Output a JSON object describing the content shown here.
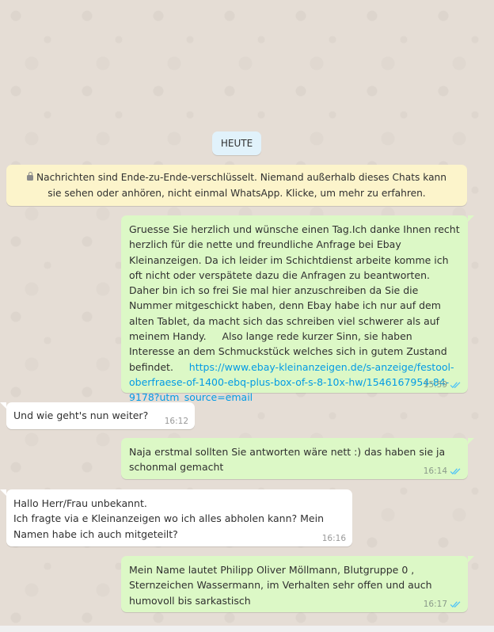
{
  "date_chip": "HEUTE",
  "encryption_notice": "Nachrichten sind Ende-zu-Ende-verschlüsselt. Niemand außerhalb dieses Chats kann sie sehen oder anhören, nicht einmal WhatsApp. Klicke, um mehr zu erfahren.",
  "messages": [
    {
      "direction": "outgoing",
      "text": "Gruesse Sie herzlich und wünsche einen Tag.Ich danke Ihnen recht herzlich für die nette und freundliche Anfrage bei Ebay Kleinanzeigen. Da ich leider im Schichtdienst arbeite komme ich oft nicht oder verspätete dazu die Anfragen zu beantworten.     Daher bin ich so frei Sie mal hier anzuschreiben da Sie die Nummer mitgeschickt haben, denn Ebay habe ich nur auf dem alten Tablet, da macht sich das schreiben viel schwerer als auf meinem Handy.     Also lange rede kurzer Sinn, sie haben Interesse an dem Schmuckstück welches sich in gutem Zustand befindet.     ",
      "link": "https://www.ebay-kleinanzeigen.de/s-anzeige/festool-oberfraese-of-1400-ebq-plus-box-of-s-8-10x-hw/1546167954-84-9178?utm_source=email",
      "time": "15:59",
      "status_icon": "double-check-read-icon"
    },
    {
      "direction": "incoming",
      "text": "Und wie geht's nun weiter?",
      "time": "16:12"
    },
    {
      "direction": "outgoing",
      "text": "Naja erstmal sollten Sie antworten wäre nett :) das haben sie ja schonmal gemacht",
      "time": "16:14",
      "status_icon": "double-check-read-icon"
    },
    {
      "direction": "incoming",
      "text": "Hallo Herr/Frau unbekannt.\nIch fragte via e Kleinanzeigen wo ich alles abholen kann? Mein Namen habe ich auch mitgeteilt?",
      "time": "16:16"
    },
    {
      "direction": "outgoing",
      "text": "Mein Name lautet Philipp Oliver Möllmann, Blutgruppe 0 , Sternzeichen Wassermann, im Verhalten sehr offen und auch humovoll bis sarkastisch",
      "time": "16:17",
      "status_icon": "double-check-read-icon"
    }
  ],
  "colors": {
    "wallpaper": "#e5ddd5",
    "outgoing_bubble": "#dcf8c6",
    "incoming_bubble": "#ffffff",
    "notice_bg": "#fcf4cb",
    "date_chip_bg": "#e1f2fb",
    "link": "#039be5",
    "read_ticks": "#4fc3f7"
  }
}
